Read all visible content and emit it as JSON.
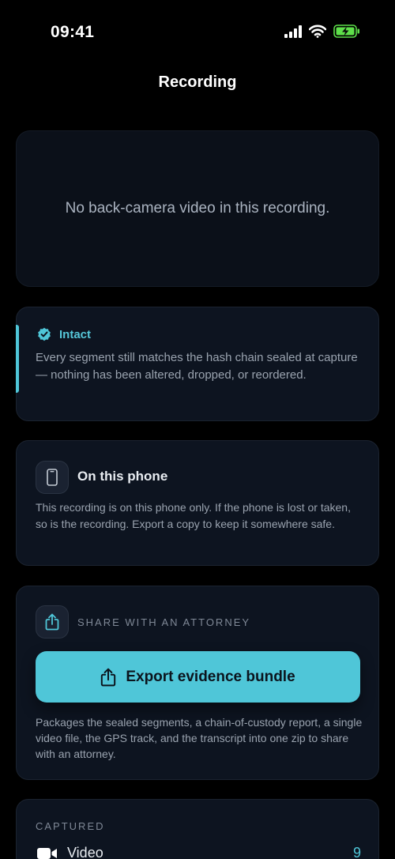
{
  "status": {
    "time": "09:41"
  },
  "nav": {
    "title": "Recording"
  },
  "video": {
    "message": "No back-camera video in this recording."
  },
  "integrity": {
    "title": "Intact",
    "body": "Every segment still matches the hash chain sealed at capture — nothing has been altered, dropped, or reordered."
  },
  "storage": {
    "title": "On this phone",
    "body": "This recording is on this phone only. If the phone is lost or taken, so is the recording. Export a copy to keep it somewhere safe."
  },
  "share": {
    "label": "SHARE WITH AN ATTORNEY",
    "button_label": "Export evidence bundle",
    "body": "Packages the sealed segments, a chain-of-custody report, a single video file, the GPS track, and the transcript into one zip to share with an attorney."
  },
  "captured": {
    "label": "CAPTURED",
    "items": [
      {
        "name": "Video",
        "count": "9"
      }
    ]
  },
  "colors": {
    "accent": "#4fc6d8",
    "battery": "#5ee04a",
    "card_bg": "#0d1420",
    "background": "#000000"
  },
  "icons": {
    "signal": "cellular-signal-icon",
    "wifi": "wifi-icon",
    "battery": "battery-charging-icon",
    "intact": "verified-badge-icon",
    "phone": "smartphone-icon",
    "share": "share-icon",
    "video": "video-camera-icon"
  }
}
